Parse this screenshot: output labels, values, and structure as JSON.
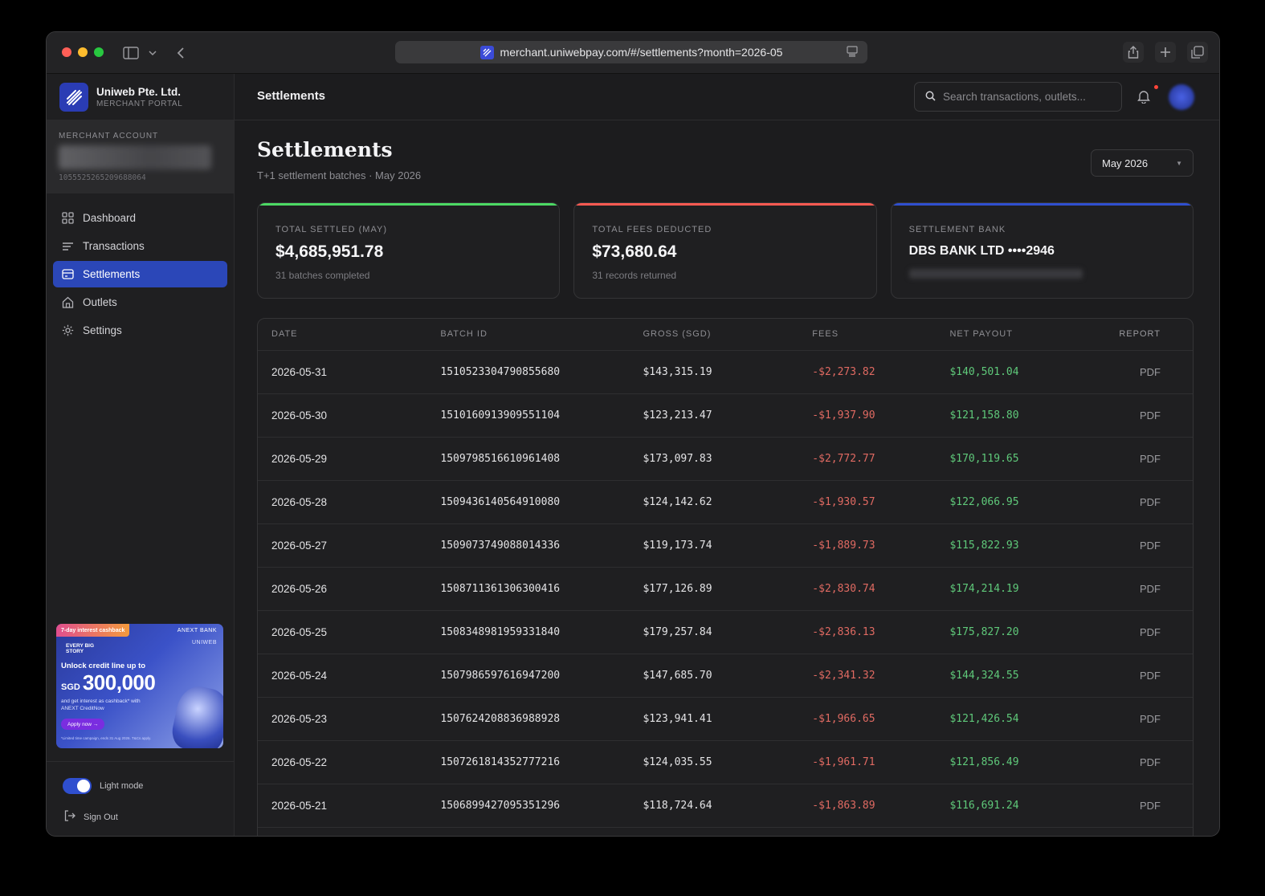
{
  "browser": {
    "url": "merchant.uniwebpay.com/#/settlements?month=2026-05"
  },
  "brand": {
    "name": "Uniweb Pte. Ltd.",
    "subtitle": "MERCHANT PORTAL"
  },
  "account": {
    "label": "MERCHANT ACCOUNT",
    "id": "1055525265209688064"
  },
  "nav": {
    "items": [
      {
        "label": "Dashboard",
        "icon": "grid-icon"
      },
      {
        "label": "Transactions",
        "icon": "list-icon"
      },
      {
        "label": "Settlements",
        "icon": "card-icon",
        "active": true
      },
      {
        "label": "Outlets",
        "icon": "store-icon"
      },
      {
        "label": "Settings",
        "icon": "gear-icon"
      }
    ]
  },
  "promo": {
    "tag": "7-day interest cashback",
    "bank": "ANEXT BANK",
    "partner": "UNIWEB",
    "every": "EVERY BIG STORY",
    "headline": "Unlock credit line up to",
    "currency": "SGD",
    "amount": "300,000",
    "body": "and get interest as cashback* with ANEXT CreditNow",
    "cta": "Apply now →",
    "fine": "*Limited time campaign, ends 31 Aug 2026. T&Cs apply."
  },
  "sidebar_bottom": {
    "theme_label": "Light mode",
    "signout_label": "Sign Out"
  },
  "topbar": {
    "title": "Settlements",
    "search_placeholder": "Search transactions, outlets..."
  },
  "page": {
    "title": "Settlements",
    "subtitle": "T+1 settlement batches · May 2026",
    "month": "May 2026"
  },
  "cards": [
    {
      "label": "TOTAL SETTLED (MAY)",
      "value": "$4,685,951.78",
      "sub": "31 batches completed",
      "accent": "#4cd964"
    },
    {
      "label": "TOTAL FEES DEDUCTED",
      "value": "$73,680.64",
      "sub": "31 records returned",
      "accent": "#ff5a52"
    },
    {
      "label": "SETTLEMENT BANK",
      "value": "DBS BANK LTD ••••2946",
      "accent": "#2f4fcf"
    }
  ],
  "table": {
    "headers": {
      "date": "DATE",
      "batch": "BATCH ID",
      "gross": "GROSS (SGD)",
      "fees": "FEES",
      "net": "NET PAYOUT",
      "report": "REPORT"
    },
    "rows": [
      {
        "date": "2026-05-31",
        "batch": "1510523304790855680",
        "gross": "$143,315.19",
        "fees": "-$2,273.82",
        "net": "$140,501.04",
        "report": "PDF"
      },
      {
        "date": "2026-05-30",
        "batch": "1510160913909551104",
        "gross": "$123,213.47",
        "fees": "-$1,937.90",
        "net": "$121,158.80",
        "report": "PDF"
      },
      {
        "date": "2026-05-29",
        "batch": "1509798516610961408",
        "gross": "$173,097.83",
        "fees": "-$2,772.77",
        "net": "$170,119.65",
        "report": "PDF"
      },
      {
        "date": "2026-05-28",
        "batch": "1509436140564910080",
        "gross": "$124,142.62",
        "fees": "-$1,930.57",
        "net": "$122,066.95",
        "report": "PDF"
      },
      {
        "date": "2026-05-27",
        "batch": "1509073749088014336",
        "gross": "$119,173.74",
        "fees": "-$1,889.73",
        "net": "$115,822.93",
        "report": "PDF"
      },
      {
        "date": "2026-05-26",
        "batch": "1508711361306300416",
        "gross": "$177,126.89",
        "fees": "-$2,830.74",
        "net": "$174,214.19",
        "report": "PDF"
      },
      {
        "date": "2026-05-25",
        "batch": "1508348981959331840",
        "gross": "$179,257.84",
        "fees": "-$2,836.13",
        "net": "$175,827.20",
        "report": "PDF"
      },
      {
        "date": "2026-05-24",
        "batch": "1507986597616947200",
        "gross": "$147,685.70",
        "fees": "-$2,341.32",
        "net": "$144,324.55",
        "report": "PDF"
      },
      {
        "date": "2026-05-23",
        "batch": "1507624208836988928",
        "gross": "$123,941.41",
        "fees": "-$1,966.65",
        "net": "$121,426.54",
        "report": "PDF"
      },
      {
        "date": "2026-05-22",
        "batch": "1507261814352777216",
        "gross": "$124,035.55",
        "fees": "-$1,961.71",
        "net": "$121,856.49",
        "report": "PDF"
      },
      {
        "date": "2026-05-21",
        "batch": "1506899427095351296",
        "gross": "$118,724.64",
        "fees": "-$1,863.89",
        "net": "$116,691.24",
        "report": "PDF"
      }
    ]
  }
}
